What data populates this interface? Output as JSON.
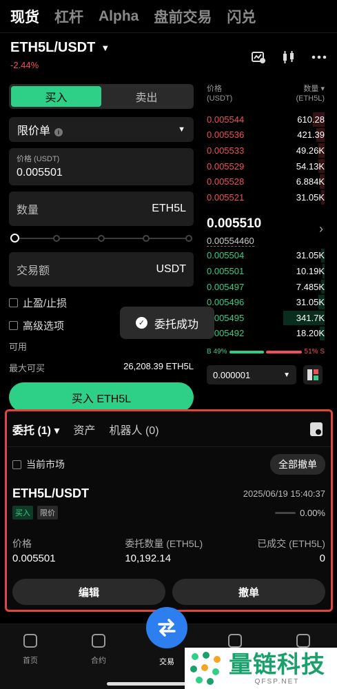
{
  "topnav": {
    "tabs": [
      "现货",
      "杠杆",
      "Alpha",
      "盘前交易",
      "闪兑"
    ],
    "active_index": 0
  },
  "pair": {
    "symbol": "ETH5L/USDT",
    "change": "-2.44%"
  },
  "pair_icons": [
    "chart-settings-icon",
    "candlestick-icon",
    "more-icon"
  ],
  "trade": {
    "buy_label": "买入",
    "sell_label": "卖出",
    "order_type": "限价单",
    "price_label": "价格 (USDT)",
    "price_value": "0.005501",
    "qty_placeholder": "数量",
    "qty_unit": "ETH5L",
    "amount_placeholder": "交易额",
    "amount_unit": "USDT",
    "tpsl_label": "止盈/止损",
    "advanced_label": "高级选项",
    "available_label": "可用",
    "max_buy_label": "最大可买",
    "max_buy_value": "26,208.39 ETH5L",
    "submit_label": "买入 ETH5L"
  },
  "book": {
    "price_header": "价格",
    "price_unit": "(USDT)",
    "qty_header": "数量",
    "qty_unit": "(ETH5L)",
    "asks": [
      {
        "price": "0.005544",
        "qty": "610.28",
        "depth": 0.1
      },
      {
        "price": "0.005536",
        "qty": "421.39",
        "depth": 0.07
      },
      {
        "price": "0.005533",
        "qty": "49.26K",
        "depth": 0.05
      },
      {
        "price": "0.005529",
        "qty": "54.13K",
        "depth": 0.05
      },
      {
        "price": "0.005528",
        "qty": "6.884K",
        "depth": 0.04
      },
      {
        "price": "0.005521",
        "qty": "31.05K",
        "depth": 0.03
      }
    ],
    "last_price": "0.005510",
    "mark_price": "0.00554460",
    "bids": [
      {
        "price": "0.005504",
        "qty": "31.05K",
        "depth": 0.03
      },
      {
        "price": "0.005501",
        "qty": "10.19K",
        "depth": 0.02
      },
      {
        "price": "0.005497",
        "qty": "7.485K",
        "depth": 0.03
      },
      {
        "price": "0.005496",
        "qty": "31.05K",
        "depth": 0.05
      },
      {
        "price": "0.005495",
        "qty": "341.7K",
        "depth": 0.35
      },
      {
        "price": "0.005492",
        "qty": "18.20K",
        "depth": 0.04
      }
    ],
    "buy_ratio_label": "B 49%",
    "sell_ratio_label": "51% S",
    "buy_ratio": 0.49,
    "precision": "0.000001"
  },
  "toast": {
    "text": "委托成功"
  },
  "orders": {
    "tabs": [
      "委托 (1)",
      "资产",
      "机器人 (0)"
    ],
    "current_market_label": "当前市场",
    "cancel_all_label": "全部撤单",
    "order": {
      "symbol": "ETH5L/USDT",
      "time": "2025/06/19 15:40:37",
      "side_tag": "买入",
      "type_tag": "限价",
      "filled_pct": "0.00%",
      "price_label": "价格",
      "price_value": "0.005501",
      "qty_label": "委托数量 (ETH5L)",
      "qty_value": "10,192.14",
      "filled_label": "已成交 (ETH5L)",
      "filled_value": "0",
      "edit_label": "编辑",
      "cancel_label": "撤单"
    }
  },
  "bottomnav": {
    "items": [
      "首页",
      "合约",
      "交易"
    ]
  },
  "watermark": {
    "cn": "量链科技",
    "en": "QFSP.NET"
  },
  "colors": {
    "buy": "#2ed088",
    "sell": "#f0505a",
    "accent": "#2d7ff0"
  }
}
